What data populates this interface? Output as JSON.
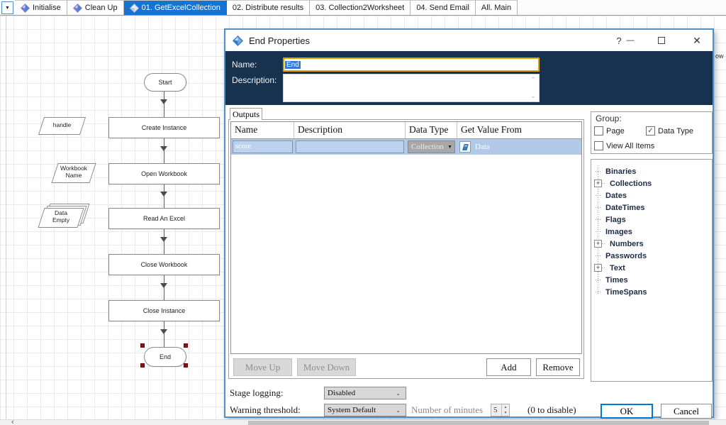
{
  "icons": {
    "tab_dropdown": "▼",
    "dropdown_arrow": "▼",
    "select_arrow": "⌄",
    "spinner_up": "▲",
    "spinner_down": "▼",
    "scroll_up": "⌃",
    "scroll_down": "⌄",
    "scroll_left": "‹",
    "help": "?",
    "minimize": "—",
    "close": "✕",
    "check": "✓",
    "plus": "+"
  },
  "colors": {
    "active_tab": "#1673d2",
    "navy_header": "#16324f",
    "name_border": "#dfa100",
    "selected_row": "#b3c9e8",
    "ok_focus": "#0078d7",
    "dialog_border": "#4f8fcc"
  },
  "tabs": {
    "items": [
      {
        "label": "Initialise"
      },
      {
        "label": "Clean Up"
      },
      {
        "label": "01. GetExcelCollection"
      },
      {
        "label": "02. Distribute results"
      },
      {
        "label": "03. Collection2Worksheet"
      },
      {
        "label": "04. Send Email"
      },
      {
        "label": "All. Main"
      }
    ]
  },
  "canvas": {
    "stages": {
      "start": "Start",
      "create_instance": "Create Instance",
      "open_workbook": "Open Workbook",
      "read_an_excel": "Read An Excel",
      "close_workbook": "Close Workbook",
      "close_instance": "Close Instance",
      "end": "End"
    },
    "data_items": {
      "handle": "handle",
      "workbook_name_line1": "Workbook",
      "workbook_name_line2": "Name",
      "data_empty_line1": "Data",
      "data_empty_line2": "Empty"
    },
    "partial_text": "ow"
  },
  "dialog": {
    "title": "End Properties",
    "name_label": "Name:",
    "name_value": "End",
    "description_label": "Description:",
    "description_value": "",
    "outputs_tab": "Outputs",
    "table": {
      "headers": [
        "Name",
        "Description",
        "Data Type",
        "Get Value From"
      ],
      "rows": [
        {
          "name": "score",
          "description": "",
          "data_type": "Collection",
          "get_value_from": "Data"
        }
      ]
    },
    "buttons": {
      "move_up": "Move Up",
      "move_down": "Move Down",
      "add": "Add",
      "remove": "Remove",
      "ok": "OK",
      "cancel": "Cancel"
    },
    "stage_logging_label": "Stage logging:",
    "stage_logging_value": "Disabled",
    "warning_threshold_label": "Warning threshold:",
    "warning_threshold_value": "System Default",
    "number_of_minutes_label": "Number of minutes",
    "minutes_value": "5",
    "disable_hint": "(0 to disable)"
  },
  "group_panel": {
    "title": "Group:",
    "checkboxes": [
      {
        "label": "Page",
        "glyph": ""
      },
      {
        "label": "Data Type",
        "glyph": "✓"
      },
      {
        "label": "View All Items",
        "glyph": ""
      }
    ],
    "tree": [
      {
        "label": "Binaries",
        "toggle": ""
      },
      {
        "label": "Collections",
        "toggle": "+"
      },
      {
        "label": "Dates",
        "toggle": ""
      },
      {
        "label": "DateTimes",
        "toggle": ""
      },
      {
        "label": "Flags",
        "toggle": ""
      },
      {
        "label": "Images",
        "toggle": ""
      },
      {
        "label": "Numbers",
        "toggle": "+"
      },
      {
        "label": "Passwords",
        "toggle": ""
      },
      {
        "label": "Text",
        "toggle": "+"
      },
      {
        "label": "Times",
        "toggle": ""
      },
      {
        "label": "TimeSpans",
        "toggle": ""
      }
    ]
  }
}
